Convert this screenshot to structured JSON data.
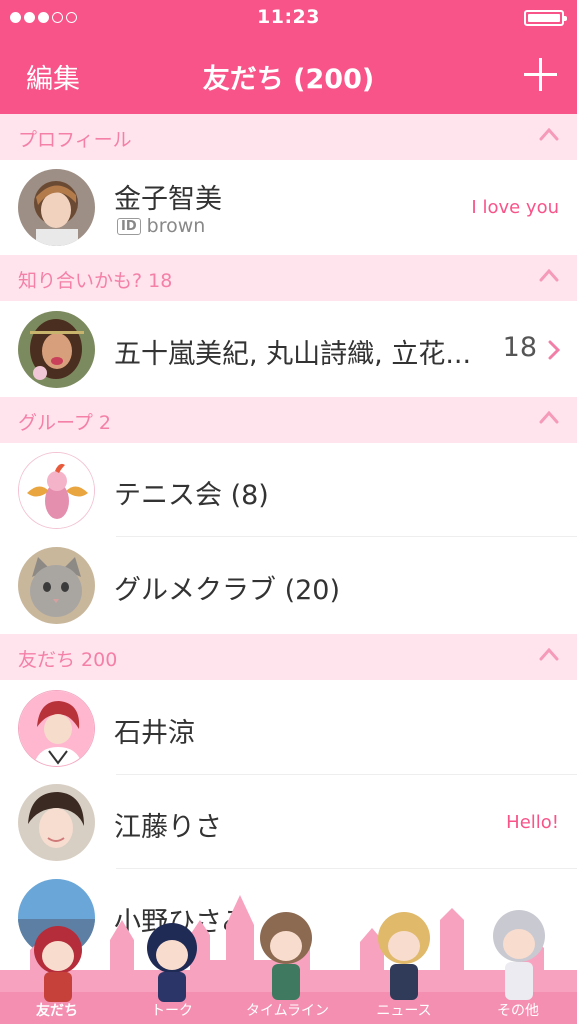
{
  "status_bar": {
    "time": "11:23"
  },
  "nav": {
    "edit": "編集",
    "title": "友だち (200)"
  },
  "sections": {
    "profile": "プロフィール",
    "suggest": "知り合いかも? 18",
    "groups": "グループ 2",
    "friends": "友だち 200"
  },
  "profile": {
    "name": "金子智美",
    "id_badge": "ID",
    "id": "brown",
    "status": "I love you"
  },
  "suggest": {
    "names": "五十嵐美紀, 丸山詩織, 立花...",
    "count": "18"
  },
  "groups": [
    {
      "name": "テニス会 (8)"
    },
    {
      "name": "グルメクラブ (20)"
    }
  ],
  "friends": [
    {
      "name": "石井涼",
      "status": ""
    },
    {
      "name": "江藤りさ",
      "status": "Hello!"
    },
    {
      "name": "小野ひさみ",
      "status": ""
    }
  ],
  "tabs": [
    {
      "label": "友だち"
    },
    {
      "label": "トーク"
    },
    {
      "label": "タイムライン"
    },
    {
      "label": "ニュース"
    },
    {
      "label": "その他"
    }
  ],
  "colors": {
    "brand": "#f8548a",
    "section_bg": "#ffe4ee",
    "section_text": "#f480a8",
    "tab_bg": "#f7a3bf"
  }
}
